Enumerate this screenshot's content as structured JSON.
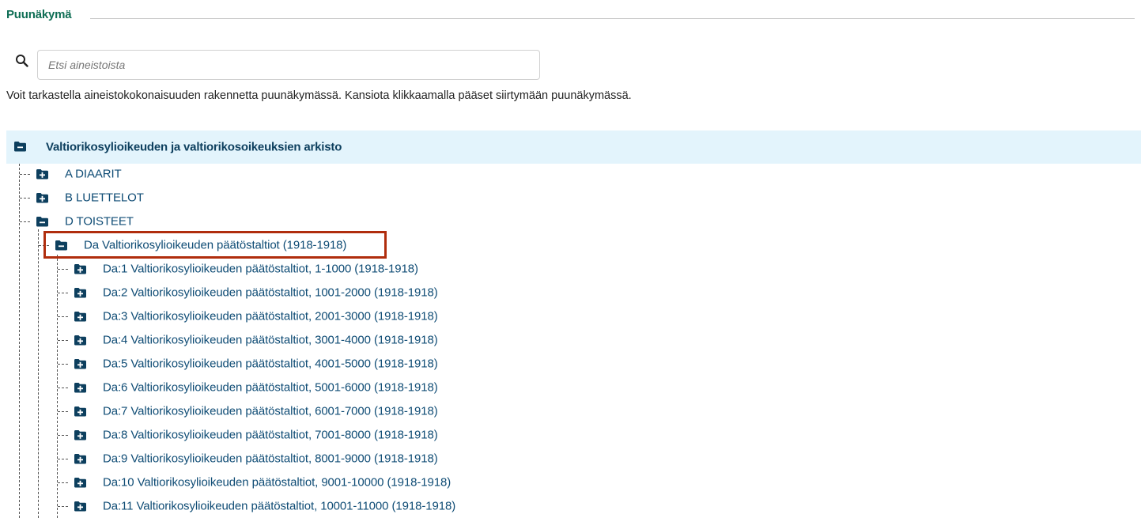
{
  "header": {
    "title": "Puunäkymä"
  },
  "search": {
    "placeholder": "Etsi aineistoista",
    "value": ""
  },
  "description": "Voit tarkastella aineistokokonaisuuden rakennetta puunäkymässä. Kansiota klikkaamalla pääset siirtymään puunäkymässä.",
  "tree": {
    "root": {
      "label": "Valtiorikosylioikeuden ja valtiorikosoikeuksien arkisto",
      "state": "expanded"
    },
    "level1": [
      {
        "label": "A DIAARIT",
        "state": "collapsed"
      },
      {
        "label": "B LUETTELOT",
        "state": "collapsed"
      },
      {
        "label": "D TOISTEET",
        "state": "expanded"
      }
    ],
    "selected": {
      "label": "Da Valtiorikosylioikeuden päätöstaltiot (1918-1918)",
      "state": "expanded"
    },
    "children": [
      {
        "label": "Da:1 Valtiorikosylioikeuden päätöstaltiot, 1-1000 (1918-1918)",
        "state": "collapsed"
      },
      {
        "label": "Da:2 Valtiorikosylioikeuden päätöstaltiot, 1001-2000 (1918-1918)",
        "state": "collapsed"
      },
      {
        "label": "Da:3 Valtiorikosylioikeuden päätöstaltiot, 2001-3000 (1918-1918)",
        "state": "collapsed"
      },
      {
        "label": "Da:4 Valtiorikosylioikeuden päätöstaltiot, 3001-4000 (1918-1918)",
        "state": "collapsed"
      },
      {
        "label": "Da:5 Valtiorikosylioikeuden päätöstaltiot, 4001-5000 (1918-1918)",
        "state": "collapsed"
      },
      {
        "label": "Da:6 Valtiorikosylioikeuden päätöstaltiot, 5001-6000 (1918-1918)",
        "state": "collapsed"
      },
      {
        "label": "Da:7 Valtiorikosylioikeuden päätöstaltiot, 6001-7000 (1918-1918)",
        "state": "collapsed"
      },
      {
        "label": "Da:8 Valtiorikosylioikeuden päätöstaltiot, 7001-8000 (1918-1918)",
        "state": "collapsed"
      },
      {
        "label": "Da:9 Valtiorikosylioikeuden päätöstaltiot, 8001-9000 (1918-1918)",
        "state": "collapsed"
      },
      {
        "label": "Da:10 Valtiorikosylioikeuden päätöstaltiot, 9001-10000 (1918-1918)",
        "state": "collapsed"
      },
      {
        "label": "Da:11 Valtiorikosylioikeuden päätöstaltiot, 10001-11000 (1918-1918)",
        "state": "collapsed"
      }
    ]
  },
  "colors": {
    "title": "#0f6e55",
    "link": "#0f4c75",
    "folder": "#0d3f5e",
    "root_background": "#e3f4fc",
    "highlight_border": "#b02d0d"
  },
  "icons": {
    "search": "search-icon",
    "collapsed": "folder-plus-icon",
    "expanded": "folder-minus-icon"
  }
}
